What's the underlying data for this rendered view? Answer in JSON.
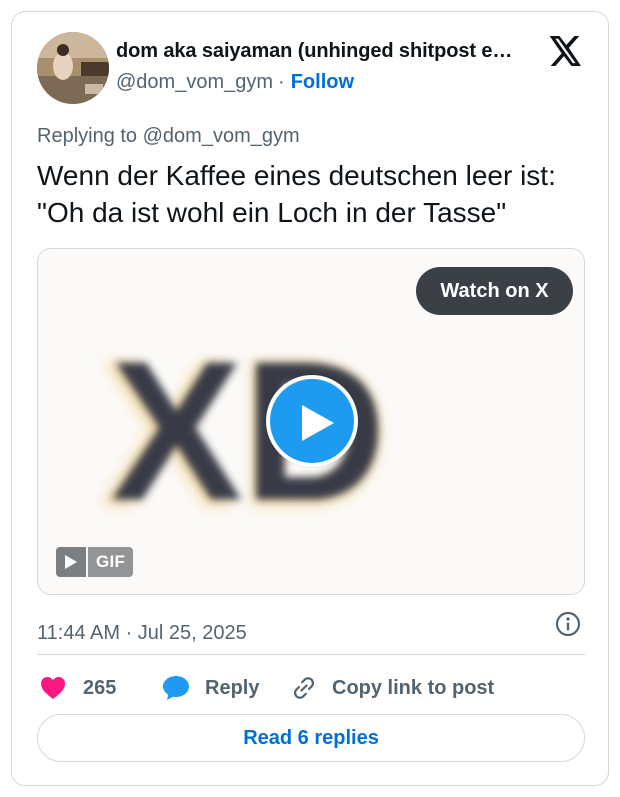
{
  "header": {
    "display_name": "dom aka saiyaman (unhinged shitpost e…",
    "handle": "@dom_vom_gym",
    "separator": "·",
    "follow_label": "Follow"
  },
  "tweet": {
    "replying_to": "Replying to @dom_vom_gym",
    "text": "Wenn der Kaffee eines deutschen leer ist: \"Oh da ist wohl ein Loch in der Tasse\"",
    "timestamp": "11:44 AM · Jul 25, 2025"
  },
  "media": {
    "watch_label": "Watch on X",
    "image_text": "XD",
    "gif_label": "GIF"
  },
  "actions": {
    "like_count": "265",
    "reply_label": "Reply",
    "copy_label": "Copy link to post"
  },
  "footer": {
    "read_replies_label": "Read 6 replies"
  },
  "colors": {
    "like": "#f91880",
    "accent": "#1d9bf0",
    "link": "#006fd6",
    "muted": "#536471",
    "border": "#cfd9de"
  },
  "icons": [
    "x-logo-icon",
    "play-icon",
    "gif-play-icon",
    "info-icon",
    "heart-icon",
    "reply-bubble-icon",
    "link-icon"
  ]
}
